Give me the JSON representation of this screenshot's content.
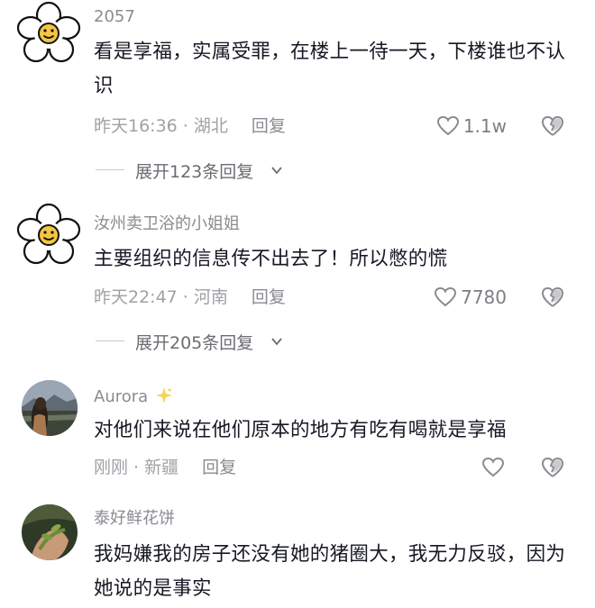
{
  "comments": [
    {
      "user": "2057",
      "text": "看是享福，实属受罪，在楼上一待一天，下楼谁也不认识",
      "time_loc": "昨天16:36 · 湖北",
      "reply": "回复",
      "likes": "1.1w",
      "expand": "展开123条回复",
      "avatar_icon": "flower-smiley-avatar"
    },
    {
      "user": "汝州卖卫浴的小姐姐",
      "text": "主要组织的信息传不出去了！所以憋的慌",
      "time_loc": "昨天22:47 · 河南",
      "reply": "回复",
      "likes": "7780",
      "expand": "展开205条回复",
      "avatar_icon": "flower-smiley-avatar"
    },
    {
      "user": "Aurora",
      "user_badge": "sparkle-icon",
      "text": "对他们来说在他们原本的地方有吃有喝就是享福",
      "time_loc": "刚刚 · 新疆",
      "reply": "回复",
      "likes": "",
      "avatar_icon": "landscape-photo-avatar"
    },
    {
      "user": "泰好鲜花饼",
      "text": "我妈嫌我的房子还没有她的猪圈大，我无力反驳，因为她说的是事实",
      "avatar_icon": "plant-photo-avatar"
    }
  ],
  "colors": {
    "text": "#161823",
    "meta": "#a0a1a6",
    "username": "#8a8b91",
    "accent_sparkle": "#f3d35a"
  }
}
